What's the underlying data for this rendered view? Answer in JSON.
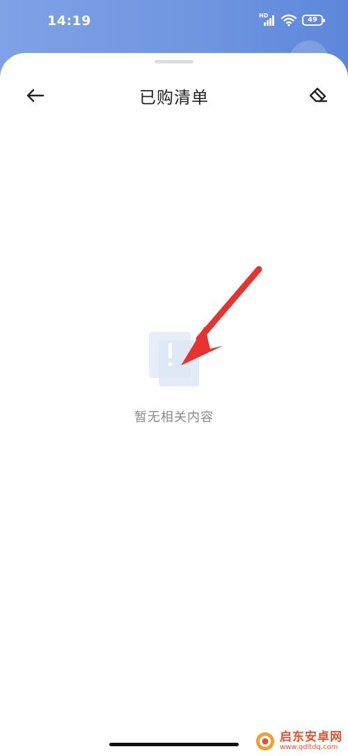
{
  "status_bar": {
    "time": "14:19",
    "network_label": "HD",
    "battery_level": "49"
  },
  "header": {
    "title": "已购清单"
  },
  "empty_state": {
    "message": "暂无相关内容"
  },
  "watermark": {
    "title": "启东安卓网",
    "url": "www.qdltdq.com"
  },
  "icons": {
    "back": "arrow-left-icon",
    "clean": "eraser-icon",
    "empty": "empty-box-icon",
    "signal": "signal-icon",
    "wifi": "wifi-icon",
    "battery": "battery-icon"
  },
  "colors": {
    "header_gradient_start": "#7ea2e6",
    "header_gradient_end": "#5d86da",
    "annotation_arrow": "#e8322f",
    "watermark": "#e5512f",
    "empty_text": "#8a8a8a"
  }
}
